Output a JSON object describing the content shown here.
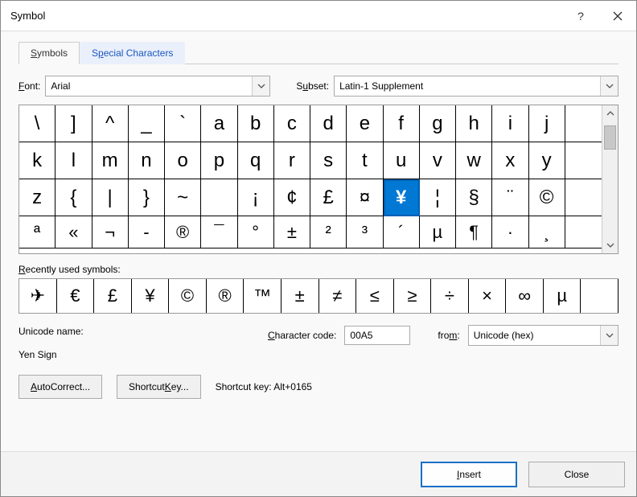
{
  "window": {
    "title": "Symbol"
  },
  "tabs": [
    {
      "label": "Symbols",
      "accel": "S",
      "active": true
    },
    {
      "label": "Special Characters",
      "accel": "P",
      "active": false
    }
  ],
  "font": {
    "label": "Font:",
    "accel": "F",
    "value": "Arial"
  },
  "subset": {
    "label": "Subset:",
    "accel": "u",
    "value": "Latin-1 Supplement"
  },
  "grid": {
    "selected": "¥",
    "rows": [
      [
        "\\",
        "]",
        "^",
        "_",
        "`",
        "a",
        "b",
        "c",
        "d",
        "e",
        "f",
        "g",
        "h",
        "i",
        "j",
        ""
      ],
      [
        "k",
        "l",
        "m",
        "n",
        "o",
        "p",
        "q",
        "r",
        "s",
        "t",
        "u",
        "v",
        "w",
        "x",
        "y",
        ""
      ],
      [
        "z",
        "{",
        "|",
        "}",
        "~",
        "",
        "¡",
        "¢",
        "£",
        "¤",
        "¥",
        "¦",
        "§",
        "¨",
        "©",
        ""
      ],
      [
        "ª",
        "«",
        "¬",
        "-",
        "®",
        "¯",
        "°",
        "±",
        "²",
        "³",
        "´",
        "µ",
        "¶",
        "·",
        "¸",
        ""
      ]
    ]
  },
  "recent": {
    "label": "Recently used symbols:",
    "accel": "R",
    "items": [
      "✈",
      "€",
      "£",
      "¥",
      "©",
      "®",
      "™",
      "±",
      "≠",
      "≤",
      "≥",
      "÷",
      "×",
      "∞",
      "µ",
      ""
    ]
  },
  "unicode": {
    "label": "Unicode name:",
    "value": "Yen Sign"
  },
  "charcode": {
    "label": "Character code:",
    "accel": "C",
    "value": "00A5"
  },
  "from": {
    "label": "from:",
    "accel": "m",
    "value": "Unicode (hex)"
  },
  "buttons": {
    "autocorrect": "AutoCorrect...",
    "autocorrect_accel": "A",
    "shortcut_key": "Shortcut Key...",
    "shortcut_key_accel": "K",
    "shortcut_text": "Shortcut key: Alt+0165",
    "insert": "Insert",
    "insert_accel": "I",
    "close": "Close"
  }
}
